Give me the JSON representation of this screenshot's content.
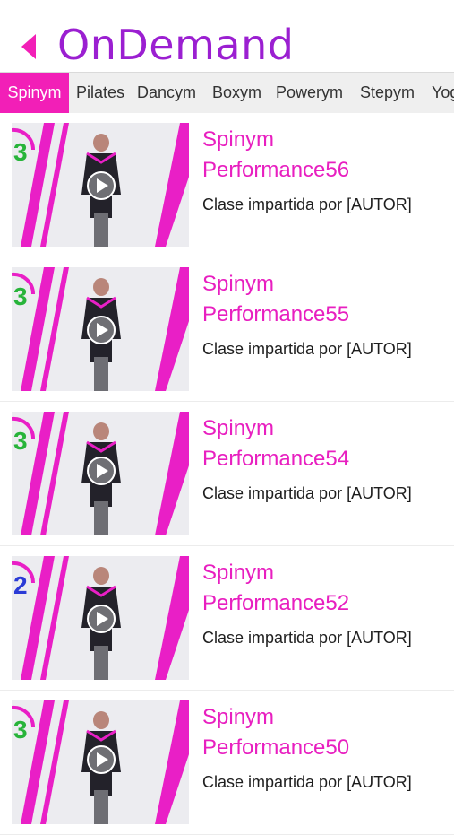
{
  "header": {
    "title": "OnDemand",
    "back_icon": "back-arrow-icon",
    "accent_color": "#9b1fd1"
  },
  "tabs": [
    "Spinym",
    "Pilates",
    "Dancym",
    "Boxym",
    "Powerym",
    "Stepym",
    "Yoga"
  ],
  "active_tab": "Spinym",
  "active_color": "#f21fb7",
  "videos": [
    {
      "title_line1": "Spinym",
      "title_line2": "Performance56",
      "subtitle": "Clase impartida por [AUTOR]",
      "level": "3"
    },
    {
      "title_line1": "Spinym",
      "title_line2": "Performance55",
      "subtitle": "Clase impartida por [AUTOR]",
      "level": "3"
    },
    {
      "title_line1": "Spinym",
      "title_line2": "Performance54",
      "subtitle": "Clase impartida por [AUTOR]",
      "level": "3"
    },
    {
      "title_line1": "Spinym",
      "title_line2": "Performance52",
      "subtitle": "Clase impartida por [AUTOR]",
      "level": "2"
    },
    {
      "title_line1": "Spinym",
      "title_line2": "Performance50",
      "subtitle": "Clase impartida por [AUTOR]",
      "level": "3"
    }
  ]
}
